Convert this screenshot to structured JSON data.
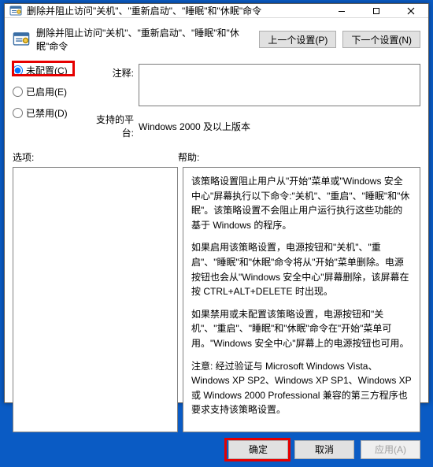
{
  "window": {
    "title": "删除并阻止访问\"关机\"、\"重新启动\"、\"睡眠\"和\"休眠\"命令"
  },
  "header": {
    "title": "删除并阻止访问\"关机\"、\"重新启动\"、\"睡眠\"和\"休眠\"命令",
    "prev": "上一个设置(P)",
    "next": "下一个设置(N)"
  },
  "radios": {
    "not_configured": "未配置(C)",
    "enabled": "已启用(E)",
    "disabled": "已禁用(D)",
    "selected": "not_configured"
  },
  "labels": {
    "comment": "注释:",
    "supported": "支持的平台:",
    "options": "选项:",
    "help": "帮助:"
  },
  "supported_value": "Windows 2000 及以上版本",
  "comment_value": "",
  "help_paragraphs": [
    "该策略设置阻止用户从\"开始\"菜单或\"Windows 安全中心\"屏幕执行以下命令:\"关机\"、\"重启\"、\"睡眠\"和\"休眠\"。该策略设置不会阻止用户运行执行这些功能的基于 Windows 的程序。",
    "如果启用该策略设置，电源按钮和\"关机\"、\"重启\"、\"睡眠\"和\"休眠\"命令将从\"开始\"菜单删除。电源按钮也会从\"Windows 安全中心\"屏幕删除，该屏幕在按 CTRL+ALT+DELETE 时出现。",
    "如果禁用或未配置该策略设置，电源按钮和\"关机\"、\"重启\"、\"睡眠\"和\"休眠\"命令在\"开始\"菜单可用。\"Windows 安全中心\"屏幕上的电源按钮也可用。",
    "注意: 经过验证与 Microsoft Windows Vista、Windows XP SP2、Windows XP SP1、Windows XP 或 Windows 2000 Professional 兼容的第三方程序也要求支持该策略设置。"
  ],
  "buttons": {
    "ok": "确定",
    "cancel": "取消",
    "apply": "应用(A)"
  }
}
